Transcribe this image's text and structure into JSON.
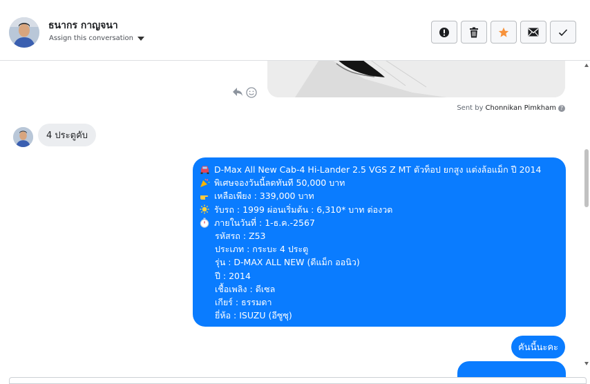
{
  "header": {
    "name": "ธนากร กาญจนา",
    "assign_label": "Assign this conversation",
    "actions": [
      {
        "name": "spam",
        "icon": "alert-circle-icon"
      },
      {
        "name": "delete",
        "icon": "trash-icon"
      },
      {
        "name": "star",
        "icon": "star-icon",
        "color": "#f7923b"
      },
      {
        "name": "unread",
        "icon": "envelope-icon"
      },
      {
        "name": "done",
        "icon": "checkmark-icon"
      }
    ]
  },
  "conversation": {
    "sent_by_prefix": "Sent by",
    "sent_by_name": "Chonnikan Pimkham",
    "incoming_message": "4 ประตูคับ",
    "outgoing_lines": [
      {
        "icon": "car-icon",
        "text": "D-Max All New Cab-4 Hi-Lander 2.5 VGS Z MT ตัวท็อป ยกสูง แต่งล้อแม็ก ปี 2014"
      },
      {
        "icon": "party-popper-icon",
        "text": "พิเศษจองวันนี้ลดทันที 50,000 บาท"
      },
      {
        "icon": "pointing-hand-icon",
        "text": "เหลือเพียง : 339,000 บาท"
      },
      {
        "icon": "sun-icon",
        "text": "รับรถ : 1999 ผ่อนเริ่มต้น : 6,310* บาท  ต่องวด"
      },
      {
        "icon": "stopwatch-icon",
        "text": "ภายในวันที่ : 1-ธ.ค.-2567"
      }
    ],
    "outgoing_details": [
      "รหัสรถ : Z53",
      "ประเภท : กระบะ 4 ประตู",
      "รุ่น : D-MAX ALL NEW (ดีแม็ก ออนิว)",
      "ปี : 2014",
      "เชื้อเพลิง : ดีเซล",
      "เกียร์ : ธรรมดา",
      "ยี่ห้อ : ISUZU (อีซูซุ)"
    ],
    "outgoing_short": "คันนี้นะคะ",
    "bubble_color": "#0a7cff"
  }
}
